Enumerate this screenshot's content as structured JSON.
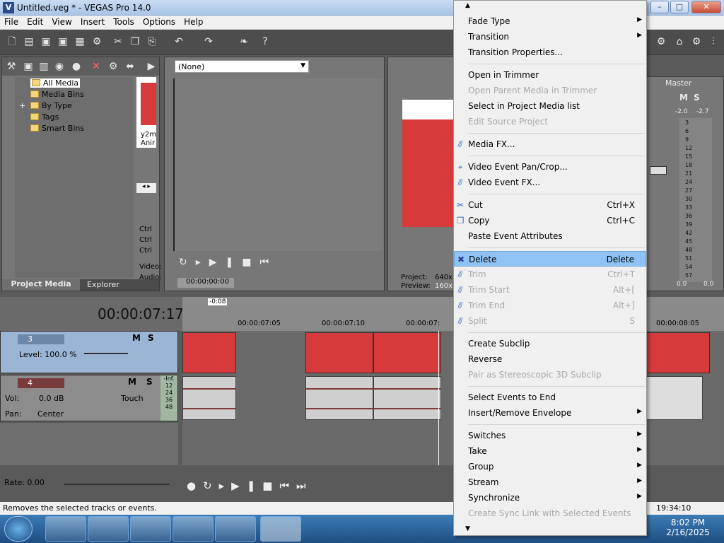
{
  "window": {
    "title": "Untitled.veg * - VEGAS Pro 14.0",
    "app_icon": "vegas-logo-icon"
  },
  "menubar": [
    "File",
    "Edit",
    "View",
    "Insert",
    "Tools",
    "Options",
    "Help"
  ],
  "project_media": {
    "tree": [
      "All Media",
      "Media Bins",
      "By Type",
      "Tags",
      "Smart Bins"
    ],
    "thumb_text": [
      "y2m",
      "Anir"
    ],
    "side_text": [
      "Ctrl",
      "Ctrl",
      "Ctrl",
      "Video:",
      "Audio:"
    ],
    "tabs": [
      "Project Media",
      "Explorer"
    ]
  },
  "trimmer": {
    "preset": "(None)",
    "timecode": "00:00:00:00"
  },
  "preview": {
    "project_label": "Project:",
    "project_value": "640x",
    "preview_label": "Preview:",
    "preview_value": "160x"
  },
  "master": {
    "label": "Master",
    "mute": "M",
    "solo": "S",
    "left_db": "-2.0",
    "right_db": "-2.7",
    "scale": [
      "3",
      "6",
      "9",
      "12",
      "15",
      "18",
      "21",
      "24",
      "27",
      "30",
      "33",
      "36",
      "39",
      "42",
      "45",
      "48",
      "51",
      "54",
      "57"
    ],
    "bottom_left": "0.0",
    "bottom_right": "0.0"
  },
  "timeline": {
    "timecode": "00:00:07:17",
    "marker": "-0:08",
    "ruler": [
      "00:00:07:05",
      "00:00:07:10",
      "00:00:07:",
      "00:00:08:05"
    ],
    "end_time": "19:34:10",
    "rate_label": "Rate: 0.00"
  },
  "tracks": [
    {
      "number": "3",
      "level_label": "Level: 100.0 %",
      "mute": "M",
      "solo": "S"
    },
    {
      "number": "4",
      "vol_label": "Vol:",
      "vol_value": "0.0 dB",
      "pan_label": "Pan:",
      "pan_value": "Center",
      "mode": "Touch",
      "mute": "M",
      "solo": "S",
      "meter": [
        "-Inf.",
        "12",
        "24",
        "36",
        "48"
      ]
    }
  ],
  "context_menu": [
    {
      "label": "Fade Type",
      "submenu": true
    },
    {
      "label": "Transition",
      "submenu": true
    },
    {
      "label": "Transition Properties..."
    },
    {
      "sep": true
    },
    {
      "label": "Open in Trimmer"
    },
    {
      "label": "Open Parent Media in Trimmer",
      "disabled": true
    },
    {
      "label": "Select in Project Media list"
    },
    {
      "label": "Edit Source Project",
      "disabled": true
    },
    {
      "sep": true
    },
    {
      "label": "Media FX...",
      "icon": "fx-plugin-icon"
    },
    {
      "sep": true
    },
    {
      "label": "Video Event Pan/Crop...",
      "icon": "crop-icon"
    },
    {
      "label": "Video Event FX...",
      "icon": "fx-plugin-icon"
    },
    {
      "sep": true
    },
    {
      "label": "Cut",
      "shortcut": "Ctrl+X",
      "icon": "scissors-icon"
    },
    {
      "label": "Copy",
      "shortcut": "Ctrl+C",
      "icon": "copy-icon"
    },
    {
      "label": "Paste Event Attributes"
    },
    {
      "sep": true
    },
    {
      "label": "Delete",
      "shortcut": "Delete",
      "icon": "delete-x-icon",
      "highlighted": true
    },
    {
      "label": "Trim",
      "shortcut": "Ctrl+T",
      "disabled": true,
      "icon": "trim-icon"
    },
    {
      "label": "Trim Start",
      "shortcut": "Alt+[",
      "disabled": true,
      "icon": "trim-icon"
    },
    {
      "label": "Trim End",
      "shortcut": "Alt+]",
      "disabled": true,
      "icon": "trim-icon"
    },
    {
      "label": "Split",
      "shortcut": "S",
      "disabled": true,
      "icon": "split-icon"
    },
    {
      "sep": true
    },
    {
      "label": "Create Subclip"
    },
    {
      "label": "Reverse"
    },
    {
      "label": "Pair as Stereoscopic 3D Subclip",
      "disabled": true
    },
    {
      "sep": true
    },
    {
      "label": "Select Events to End"
    },
    {
      "label": "Insert/Remove Envelope",
      "submenu": true
    },
    {
      "sep": true
    },
    {
      "label": "Switches",
      "submenu": true
    },
    {
      "label": "Take",
      "submenu": true
    },
    {
      "label": "Group",
      "submenu": true
    },
    {
      "label": "Stream",
      "submenu": true
    },
    {
      "label": "Synchronize",
      "submenu": true
    },
    {
      "label": "Create Sync Link with Selected Events",
      "disabled": true
    }
  ],
  "status_text": "Removes the selected tracks or events.",
  "taskbar": {
    "time": "8:02 PM",
    "date": "2/16/2025",
    "apps": [
      "internet-explorer-icon",
      "firefox-icon",
      "file-explorer-icon",
      "media-player-icon",
      "chat-app-icon",
      "vegas-pro-icon"
    ]
  },
  "colors": {
    "clip_red": "#d63a3a",
    "menu_highlight": "#8fc3f5",
    "taskbar_blue": "#1f4e82"
  }
}
